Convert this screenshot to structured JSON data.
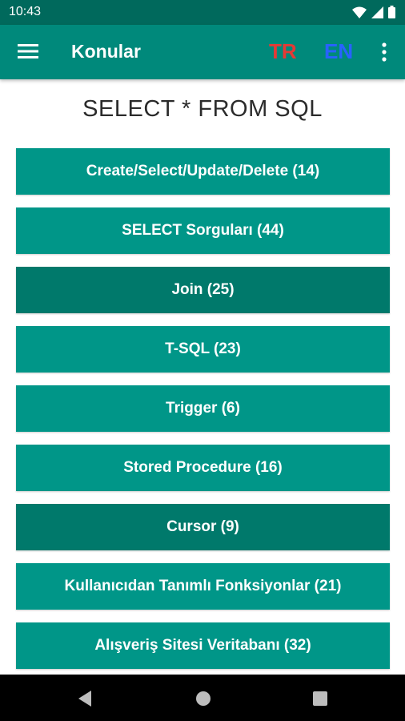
{
  "status_bar": {
    "time": "10:43"
  },
  "app_bar": {
    "title": "Konular",
    "lang_tr": "TR",
    "lang_en": "EN"
  },
  "heading": "SELECT * FROM SQL",
  "topics": [
    {
      "label": "Create/Select/Update/Delete (14)"
    },
    {
      "label": "SELECT Sorguları (44)"
    },
    {
      "label": "Join (25)"
    },
    {
      "label": "T-SQL (23)"
    },
    {
      "label": "Trigger (6)"
    },
    {
      "label": "Stored Procedure (16)"
    },
    {
      "label": "Cursor (9)"
    },
    {
      "label": "Kullanıcıdan Tanımlı Fonksiyonlar (21)"
    },
    {
      "label": "Alışveriş Sitesi Veritabanı (32)"
    }
  ],
  "colors": {
    "status_bar": "#00695c",
    "app_bar": "#00897b",
    "button": "#009688",
    "button_dark": "#00796b",
    "lang_tr": "#e53935",
    "lang_en": "#2962ff"
  },
  "icons": [
    "wifi-icon",
    "signal-icon",
    "battery-icon",
    "hamburger-menu-icon",
    "more-vert-icon",
    "back-icon",
    "home-icon",
    "recents-icon"
  ]
}
